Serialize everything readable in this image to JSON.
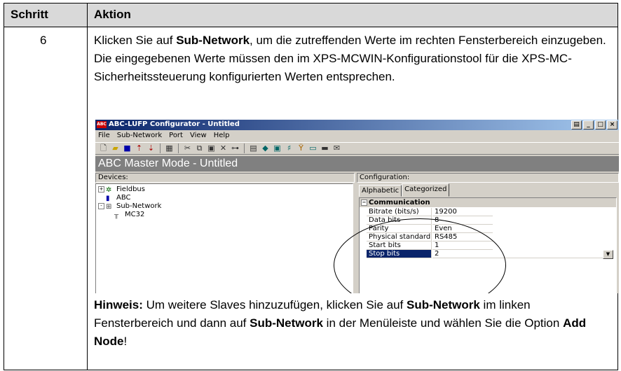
{
  "table": {
    "header_step": "Schritt",
    "header_action": "Aktion",
    "step_number": "6",
    "intro": {
      "t1": "Klicken Sie auf ",
      "b1": "Sub-Network",
      "t2": ", um die zutreffenden Werte im rechten Fensterbereich einzugeben. Die eingegebenen Werte müssen den im XPS-MCWIN-Konfigurationstool für die XPS-MC-Sicherheitssteuerung konfigurierten Werten entsprechen."
    },
    "note": {
      "label": "Hinweis:",
      "t1": " Um weitere Slaves hinzuzufügen, klicken Sie auf ",
      "b1": "Sub-Network",
      "t2": " im linken Fensterbereich und dann auf ",
      "b2": "Sub-Network",
      "t3": " in der Menüleiste und wählen Sie die Option ",
      "b3": "Add Node",
      "t4": "!"
    }
  },
  "window": {
    "app_icon": "ABC",
    "title": "ABC-LUFP Configurator - Untitled",
    "menu": [
      "File",
      "Sub-Network",
      "Port",
      "View",
      "Help"
    ],
    "banner": "ABC Master Mode - Untitled",
    "devices_label": "Devices:",
    "tree": [
      {
        "label": "Fieldbus",
        "expander": "+"
      },
      {
        "label": "ABC",
        "expander": ""
      },
      {
        "label": "Sub-Network",
        "expander": "-"
      },
      {
        "label": "MC32",
        "expander": ""
      }
    ],
    "config_label": "Configuration:",
    "tabs": [
      "Alphabetic",
      "Categorized"
    ],
    "category": "Communication",
    "properties": [
      {
        "name": "Bitrate (bits/s)",
        "value": "19200"
      },
      {
        "name": "Data bits",
        "value": "8"
      },
      {
        "name": "Parity",
        "value": "Even"
      },
      {
        "name": "Physical standard",
        "value": "RS485"
      },
      {
        "name": "Start bits",
        "value": "1"
      },
      {
        "name": "Stop bits",
        "value": "2"
      }
    ]
  },
  "icons": {
    "toolbar": [
      "new-icon",
      "open-icon",
      "save-icon",
      "upload-icon",
      "download-icon",
      "print-icon",
      "cut-icon",
      "copy-icon",
      "paste-icon",
      "delete-icon",
      "insert-icon",
      "properties-icon",
      "node-icon",
      "monitor-icon",
      "transaction-icon",
      "wizard-icon",
      "screen-icon",
      "db-icon",
      "mail-icon"
    ]
  }
}
